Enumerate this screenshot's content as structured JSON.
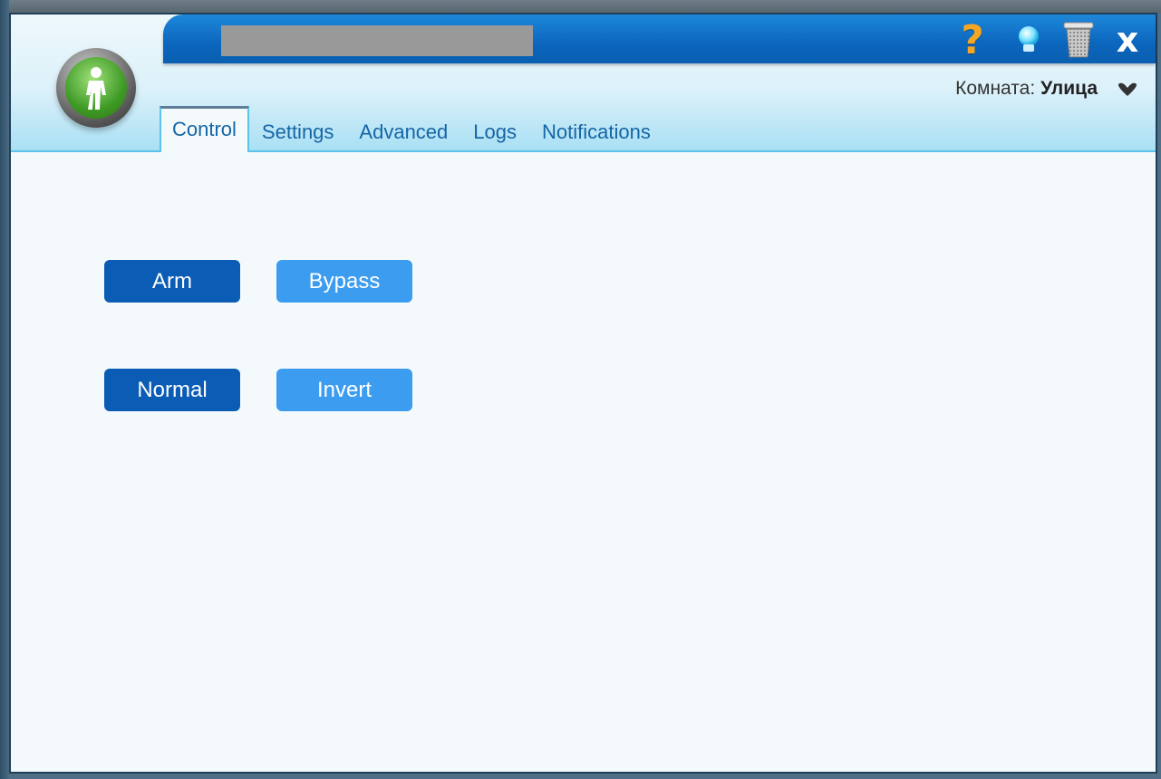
{
  "window": {
    "room_label": "Комната:",
    "room_name": "Улица"
  },
  "tabs": [
    {
      "label": "Control",
      "active": true
    },
    {
      "label": "Settings",
      "active": false
    },
    {
      "label": "Advanced",
      "active": false
    },
    {
      "label": "Logs",
      "active": false
    },
    {
      "label": "Notifications",
      "active": false
    }
  ],
  "titlebar": {
    "help_glyph": "?",
    "close_glyph": "x",
    "icons": [
      "help-icon",
      "bulb-icon",
      "trash-icon",
      "close-icon"
    ]
  },
  "controls": {
    "arm": "Arm",
    "bypass": "Bypass",
    "normal": "Normal",
    "invert": "Invert"
  },
  "colors": {
    "accent_dark": "#0a5cb4",
    "accent_light": "#3c9cf0",
    "titlebar": "#0b66bd",
    "help_icon": "#f5a623"
  }
}
